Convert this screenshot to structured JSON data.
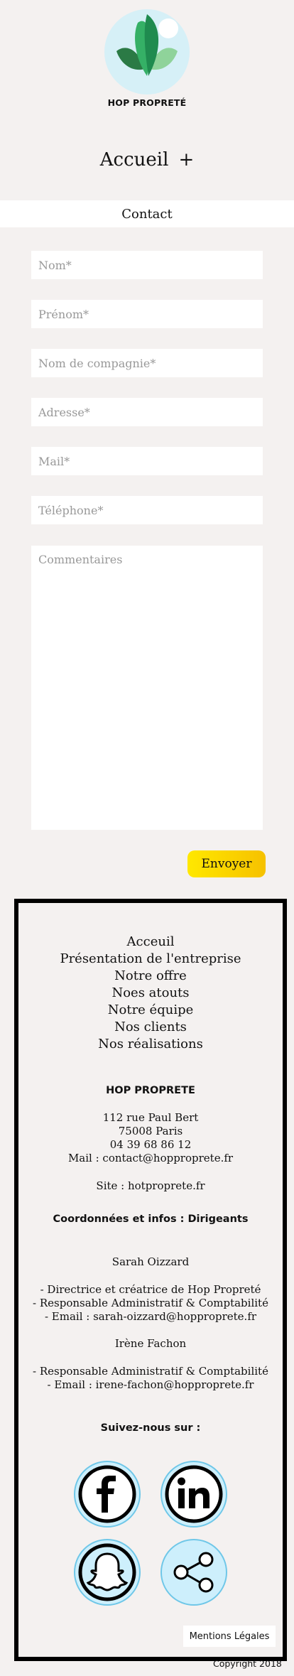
{
  "brand": {
    "name": "HOP PROPRETÉ"
  },
  "nav": {
    "label": "Accueil",
    "expand_symbol": "+"
  },
  "section": {
    "title": "Contact"
  },
  "form": {
    "name_placeholder": "Nom*",
    "firstname_placeholder": "Prénom*",
    "company_placeholder": "Nom de compagnie*",
    "address_placeholder": "Adresse*",
    "mail_placeholder": "Mail*",
    "phone_placeholder": "Téléphone*",
    "comments_placeholder": "Commentaires",
    "submit_label": "Envoyer"
  },
  "footer": {
    "links": [
      "Acceuil",
      "Présentation de l'entreprise",
      "Notre offre",
      "Noes atouts",
      "Notre équipe",
      "Nos clients",
      "Nos réalisations"
    ],
    "company_name": "HOP PROPRETE",
    "address_line1": "112 rue Paul Bert",
    "address_line2": "75008 Paris",
    "phone": "04 39 68 86 12",
    "mail": "Mail : contact@hopproprete.fr",
    "site": "Site : hotproprete.fr",
    "directors_heading": "Coordonnées et infos : Dirigeants",
    "director1_name": "Sarah Oizzard",
    "director1_role1": "- Directrice et créatrice de Hop Propreté",
    "director1_role2": "- Responsable Administratif & Comptabilité",
    "director1_email": "- Email : sarah-oizzard@hopproprete.fr",
    "director2_name": "Irène Fachon",
    "director2_role1": "- Responsable Administratif & Comptabilité",
    "director2_email": "- Email : irene-fachon@hopproprete.fr",
    "follow_label": "Suivez-nous sur :",
    "legal_label": "Mentions Légales",
    "copyright": "Copyright 2018"
  },
  "colors": {
    "accent_yellow": "#f6c100",
    "logo_green": "#2a9a55",
    "icon_fill": "#cdeffc"
  },
  "icons": [
    "facebook-icon",
    "linkedin-icon",
    "snapchat-icon",
    "share-icon"
  ]
}
